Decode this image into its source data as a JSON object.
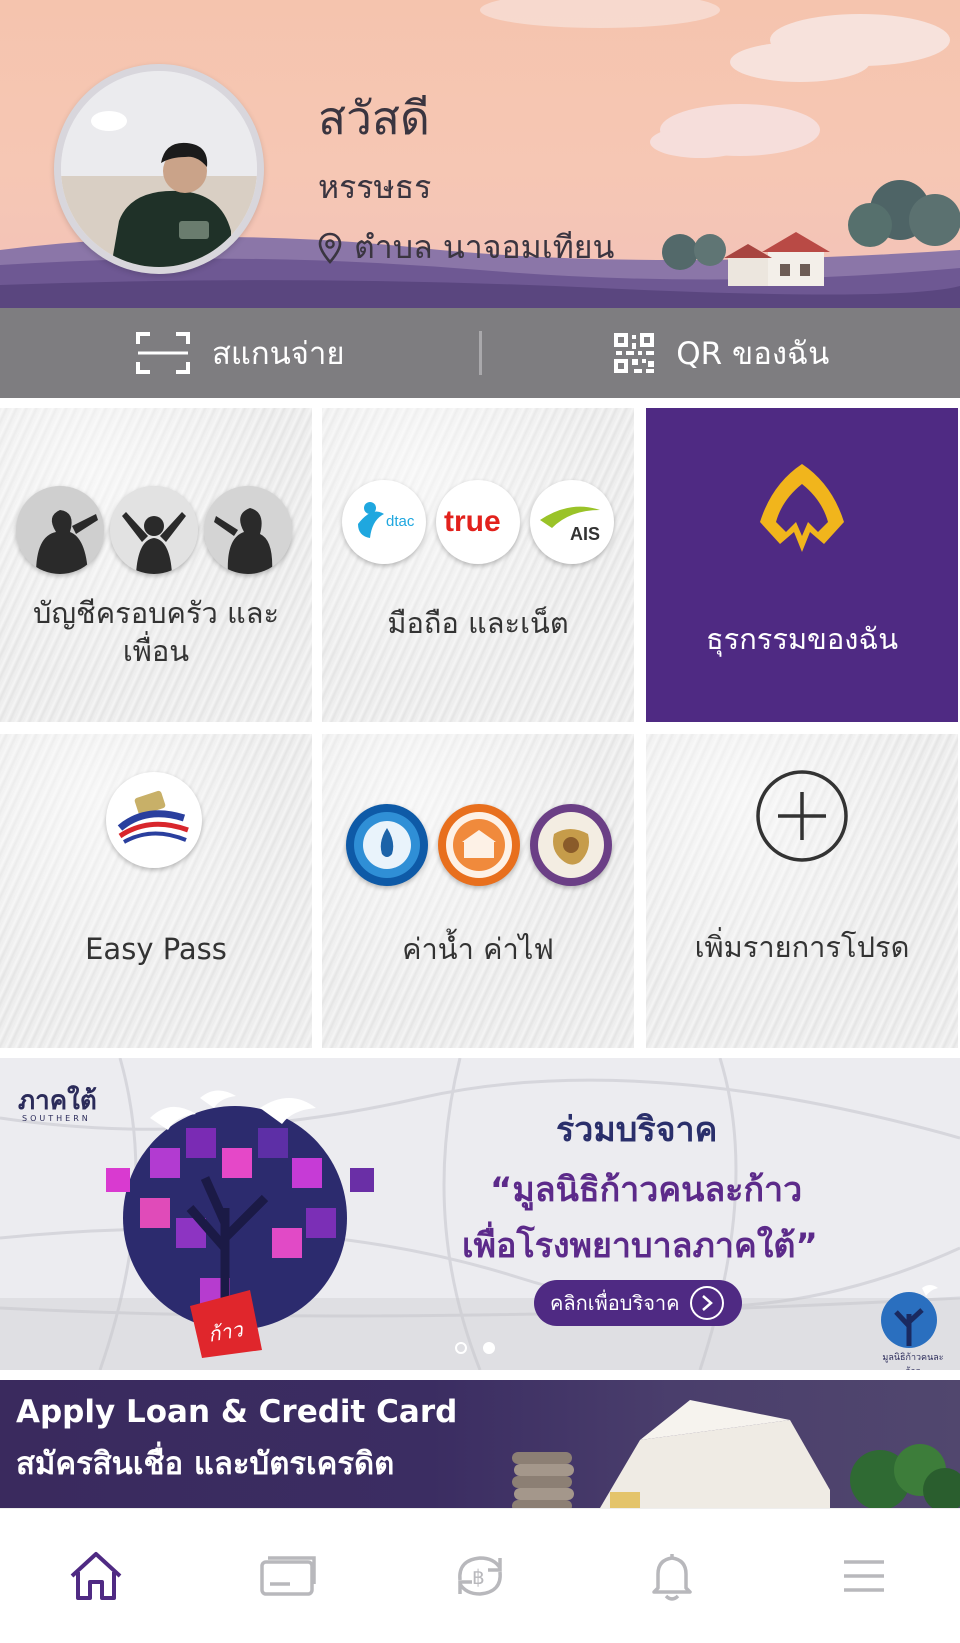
{
  "header": {
    "greeting": "สวัสดี",
    "username": "หรรษธร",
    "location": "ตำบล นาจอมเทียน",
    "icons": {
      "avatar": "user-photo",
      "location": "location-pin-icon"
    }
  },
  "quickbar": {
    "scan_label": "สแกนจ่าย",
    "qr_label": "QR ของฉัน",
    "icons": {
      "scan": "scan-frame-icon",
      "qr": "qr-code-icon"
    }
  },
  "tiles": [
    {
      "label_line1": "บัญชีครอบครัว และ",
      "label_line2": "เพื่อน"
    },
    {
      "label": "มือถือ และเน็ต",
      "logos": [
        "dtac",
        "true",
        "AIS"
      ]
    },
    {
      "label": "ธุรกรรมของฉัน",
      "icon": "scb-logo-icon"
    },
    {
      "label": "Easy Pass",
      "icon": "easy-pass-icon"
    },
    {
      "label": "ค่าน้ำ ค่าไฟ",
      "icons": [
        "water-authority-icon",
        "electricity-authority-icon",
        "provincial-electricity-icon"
      ]
    },
    {
      "label": "เพิ่มรายการโปรด",
      "icon": "plus-circle-icon"
    }
  ],
  "banner": {
    "region": "ภาคใต้",
    "region_sub": "SOUTHERN",
    "title": "ร่วมบริจาค",
    "line1": "“มูลนิธิก้าวคนละก้าว",
    "line2": "เพื่อโรงพยาบาลภาคใต้”",
    "cta": "คลิกเพื่อบริจาค",
    "puzzle_text": "ก้าว",
    "foundation_label": "มูลนิธิก้าวคนละก้าว",
    "dots": {
      "count": 2,
      "active_index": 1
    }
  },
  "loan": {
    "line1": "Apply Loan & Credit Card",
    "line2": "สมัครสินเชื่อ และบัตรเครดิต"
  },
  "bottom_nav": {
    "items": [
      "home-icon",
      "card-icon",
      "transfer-icon",
      "bell-icon",
      "menu-icon"
    ],
    "active_index": 0
  },
  "colors": {
    "brand_purple": "#4f2a83",
    "quickbar_gray": "#7e7d80",
    "header_peach": "#f5c4ae",
    "scb_gold": "#f1b51c",
    "inactive_icon": "#b8b8bc"
  }
}
